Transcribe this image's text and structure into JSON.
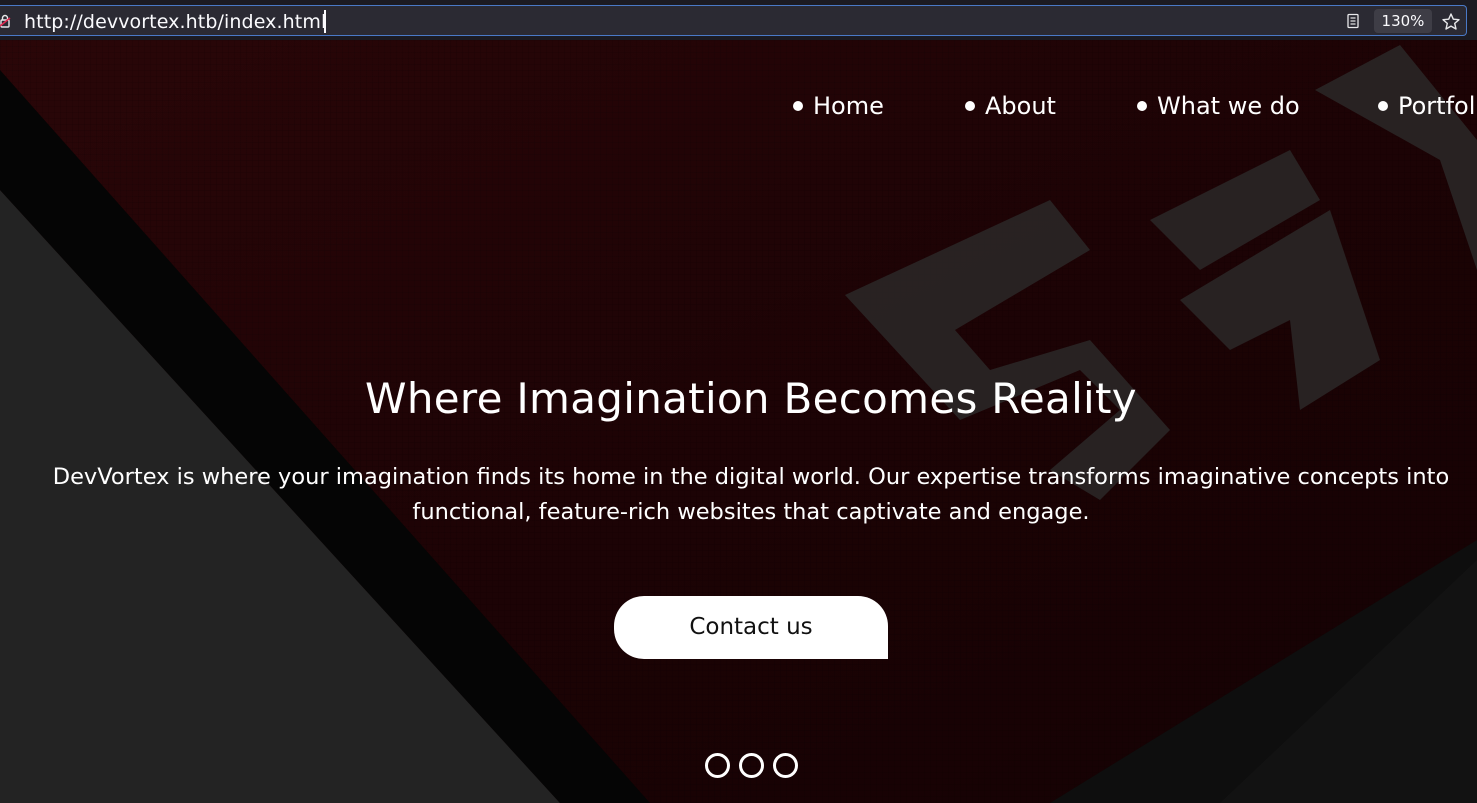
{
  "browser": {
    "url": "http://devvortex.htb/index.html",
    "zoom": "130%"
  },
  "nav": {
    "items": [
      {
        "label": "Home"
      },
      {
        "label": "About"
      },
      {
        "label": "What we do"
      },
      {
        "label": "Portfolio"
      }
    ]
  },
  "hero": {
    "headline": "Where Imagination Becomes Reality",
    "subtext_line1": "DevVortex is where your imagination finds its home in the digital world. Our expertise transforms imaginative concepts into",
    "subtext_line2": "functional, feature-rich websites that captivate and engage.",
    "cta_label": "Contact us",
    "slide_count": 3
  },
  "colors": {
    "background": "#1b0507",
    "text": "#ffffff",
    "urlbar_focus": "#4a79c7"
  }
}
